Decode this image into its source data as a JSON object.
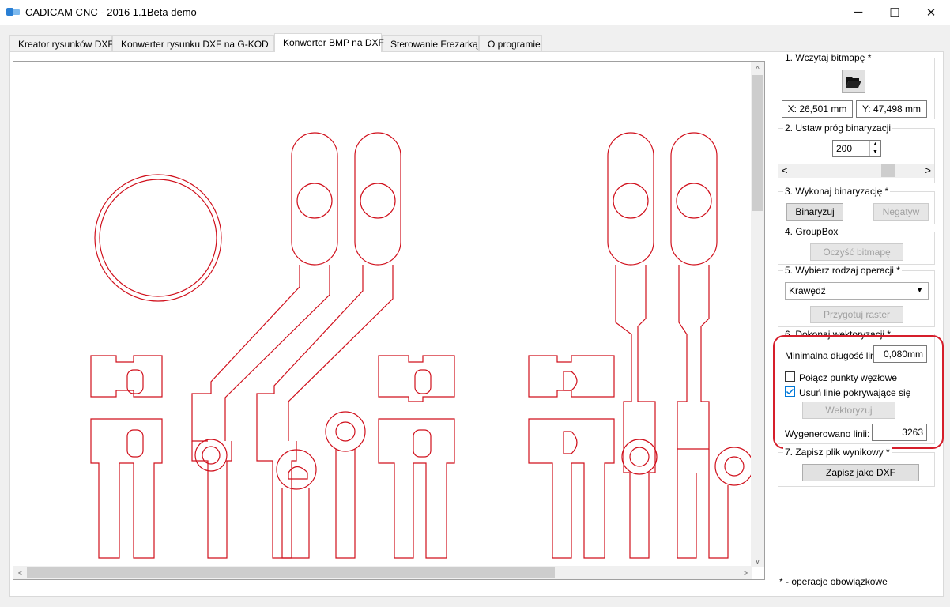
{
  "window": {
    "title": "CADICAM CNC - 2016 1.1Beta demo",
    "icon": "cadicam-logo-icon",
    "minimize_glyph": "─",
    "maximize_glyph": "☐",
    "close_glyph": "✕"
  },
  "tabs": [
    {
      "label": "Kreator rysunków DXF",
      "active": false
    },
    {
      "label": "Konwerter rysunku DXF na G-KOD",
      "active": false
    },
    {
      "label": "Konwerter BMP na DXF",
      "active": true
    },
    {
      "label": "Sterowanie Frezarką",
      "active": false
    },
    {
      "label": "O programie",
      "active": false
    }
  ],
  "canvas": {
    "drawing_color": "#d0101c",
    "hscroll_left_arrow": "<",
    "hscroll_right_arrow": ">",
    "vscroll_up_arrow": "^",
    "vscroll_down_arrow": "v"
  },
  "panel": {
    "step1": {
      "title": "1. Wczytaj bitmapę *",
      "open_icon": "folder-open-icon",
      "x_value": "X: 26,501 mm",
      "y_value": "Y: 47,498 mm"
    },
    "step2": {
      "title": "2. Ustaw próg binaryzacji",
      "threshold": "200",
      "slider_left": "<",
      "slider_right": ">"
    },
    "step3": {
      "title": "3. Wykonaj binaryzację *",
      "binarize_label": "Binaryzuj",
      "negative_label": "Negatyw"
    },
    "step4": {
      "title": "4. GroupBox",
      "clear_label": "Oczyść bitmapę"
    },
    "step5": {
      "title": "5. Wybierz rodzaj operacji *",
      "operation_selected": "Krawędź",
      "prepare_label": "Przygotuj raster"
    },
    "step6": {
      "title": "6. Dokonaj wektoryzacji *",
      "min_length_label": "Minimalna długość linii:",
      "min_length_value": "0,080mm",
      "join_nodes_label": "Połącz punkty węzłowe",
      "join_nodes_checked": false,
      "remove_overlap_label": "Usuń linie pokrywające się",
      "remove_overlap_checked": true,
      "vectorize_label": "Wektoryzuj",
      "generated_label": "Wygenerowano linii:",
      "generated_value": "3263"
    },
    "step7": {
      "title": "7. Zapisz plik wynikowy *",
      "save_label": "Zapisz jako DXF"
    },
    "footnote": "* - operacje obowiązkowe"
  },
  "highlight_color": "#d61e2b"
}
